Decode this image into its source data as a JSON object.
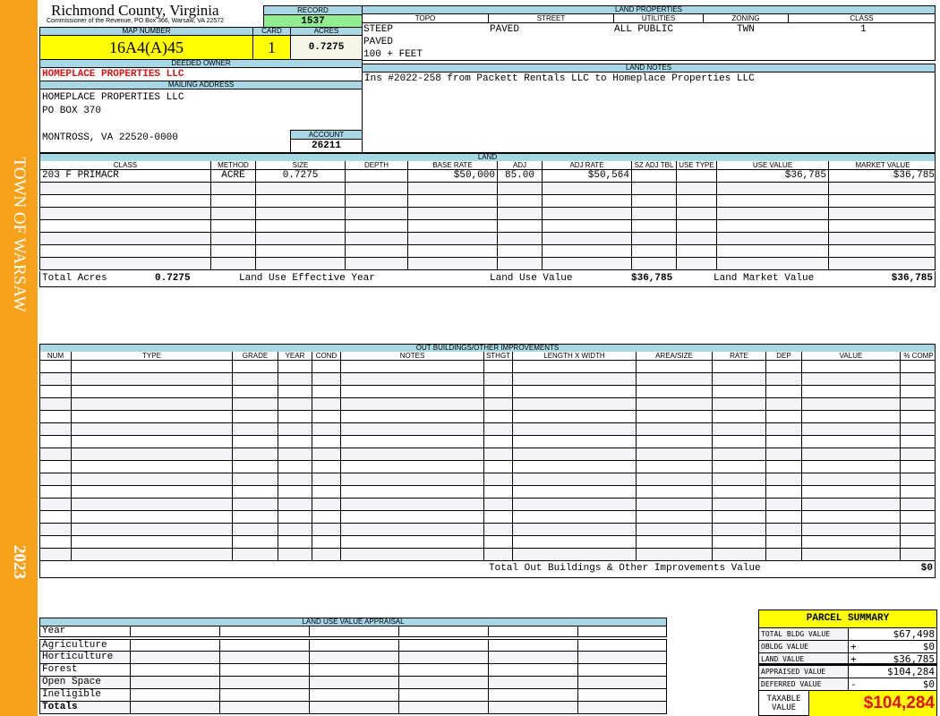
{
  "sidebar": {
    "town": "TOWN OF WARSAW",
    "year": "2023",
    "color": "#f7a11a"
  },
  "header": {
    "title": "Richmond County, Virginia",
    "subtitle": "Commissioner of the Revenue, PO Box 366, Warsaw, VA 22572"
  },
  "record": {
    "label": "RECORD",
    "value": "1537"
  },
  "map": {
    "map_label": "MAP NUMBER",
    "map_value": "16A4(A)45",
    "card_label": "CARD",
    "card_value": "1",
    "acres_label": "ACRES",
    "acres_value": "0.7275"
  },
  "owner": {
    "label": "DEEDED OWNER",
    "value": "HOMEPLACE PROPERTIES LLC"
  },
  "mailing": {
    "label": "MAILING ADDRESS",
    "lines": [
      "HOMEPLACE PROPERTIES LLC",
      "PO BOX 370",
      "MONTROSS, VA 22520-0000"
    ]
  },
  "account": {
    "label": "ACCOUNT",
    "value": "26211"
  },
  "land_properties": {
    "label": "LAND PROPERTIES",
    "headers": [
      "TOPO",
      "STREET",
      "UTILITIES",
      "ZONING",
      "CLASS"
    ],
    "topo": [
      "STEEP",
      "PAVED",
      "100 + FEET"
    ],
    "street": "PAVED",
    "utilities": "ALL PUBLIC",
    "zoning": "TWN",
    "class": "1"
  },
  "land_notes": {
    "label": "LAND NOTES",
    "text": "Ins #2022-258 from Packett Rentals LLC to Homeplace Properties LLC"
  },
  "land": {
    "label": "LAND",
    "headers": [
      "CLASS",
      "METHOD",
      "SIZE",
      "DEPTH",
      "BASE RATE",
      "ADJ",
      "ADJ RATE",
      "SZ ADJ TBL",
      "USE TYPE",
      "USE VALUE",
      "MARKET VALUE"
    ],
    "rows": [
      [
        "203 F PRIMACR",
        "ACRE",
        "0.7275",
        "",
        "$50,000",
        "85.00",
        "$50,564",
        "",
        "",
        "$36,785",
        "$36,785"
      ]
    ],
    "totals": {
      "acres_label": "Total Acres",
      "acres": "0.7275",
      "effective_year_label": "Land Use Effective Year",
      "effective_year": "",
      "use_value_label": "Land Use Value",
      "use_value": "$36,785",
      "market_value_label": "Land Market Value",
      "market_value": "$36,785"
    }
  },
  "outbuildings": {
    "label": "OUT BUILDINGS/OTHER IMPROVEMENTS",
    "headers": [
      "NUM",
      "TYPE",
      "GRADE",
      "YEAR",
      "COND",
      "NOTES",
      "STHGT",
      "LENGTH X WIDTH",
      "AREA/SIZE",
      "RATE",
      "DEP",
      "VALUE",
      "% COMP"
    ],
    "rows": [],
    "total_label": "Total Out Buildings & Other Improvements Value",
    "total": "$0"
  },
  "land_use_appraisal": {
    "label": "LAND USE VALUE APPRAISAL",
    "year_label": "Year",
    "rows": [
      "Agriculture",
      "Horticulture",
      "Forest",
      "Open Space",
      "Ineligible"
    ],
    "totals_label": "Totals"
  },
  "parcel_summary": {
    "title": "PARCEL SUMMARY",
    "rows": [
      {
        "label": "TOTAL BLDG VALUE",
        "op": "",
        "value": "$67,498"
      },
      {
        "label": "OBLDG VALUE",
        "op": "+",
        "value": "$0"
      },
      {
        "label": "LAND VALUE",
        "op": "+",
        "value": "$36,785"
      },
      {
        "label": "APPRAISED VALUE",
        "op": "",
        "value": "$104,284"
      },
      {
        "label": "DEFERRED VALUE",
        "op": "-",
        "value": "$0"
      }
    ],
    "taxable_label": "TAXABLE VALUE",
    "taxable_value": "$104,284"
  }
}
